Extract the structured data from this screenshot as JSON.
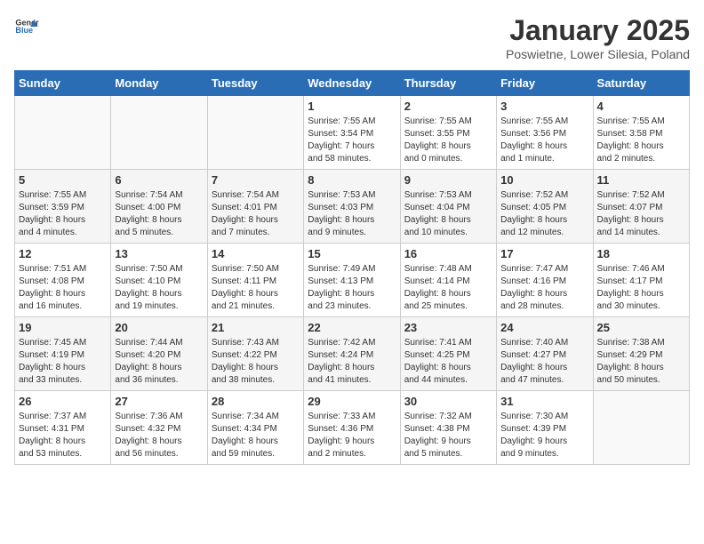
{
  "logo": {
    "general": "General",
    "blue": "Blue"
  },
  "title": "January 2025",
  "subtitle": "Poswietne, Lower Silesia, Poland",
  "days_header": [
    "Sunday",
    "Monday",
    "Tuesday",
    "Wednesday",
    "Thursday",
    "Friday",
    "Saturday"
  ],
  "weeks": [
    [
      {
        "day": "",
        "info": ""
      },
      {
        "day": "",
        "info": ""
      },
      {
        "day": "",
        "info": ""
      },
      {
        "day": "1",
        "info": "Sunrise: 7:55 AM\nSunset: 3:54 PM\nDaylight: 7 hours\nand 58 minutes."
      },
      {
        "day": "2",
        "info": "Sunrise: 7:55 AM\nSunset: 3:55 PM\nDaylight: 8 hours\nand 0 minutes."
      },
      {
        "day": "3",
        "info": "Sunrise: 7:55 AM\nSunset: 3:56 PM\nDaylight: 8 hours\nand 1 minute."
      },
      {
        "day": "4",
        "info": "Sunrise: 7:55 AM\nSunset: 3:58 PM\nDaylight: 8 hours\nand 2 minutes."
      }
    ],
    [
      {
        "day": "5",
        "info": "Sunrise: 7:55 AM\nSunset: 3:59 PM\nDaylight: 8 hours\nand 4 minutes."
      },
      {
        "day": "6",
        "info": "Sunrise: 7:54 AM\nSunset: 4:00 PM\nDaylight: 8 hours\nand 5 minutes."
      },
      {
        "day": "7",
        "info": "Sunrise: 7:54 AM\nSunset: 4:01 PM\nDaylight: 8 hours\nand 7 minutes."
      },
      {
        "day": "8",
        "info": "Sunrise: 7:53 AM\nSunset: 4:03 PM\nDaylight: 8 hours\nand 9 minutes."
      },
      {
        "day": "9",
        "info": "Sunrise: 7:53 AM\nSunset: 4:04 PM\nDaylight: 8 hours\nand 10 minutes."
      },
      {
        "day": "10",
        "info": "Sunrise: 7:52 AM\nSunset: 4:05 PM\nDaylight: 8 hours\nand 12 minutes."
      },
      {
        "day": "11",
        "info": "Sunrise: 7:52 AM\nSunset: 4:07 PM\nDaylight: 8 hours\nand 14 minutes."
      }
    ],
    [
      {
        "day": "12",
        "info": "Sunrise: 7:51 AM\nSunset: 4:08 PM\nDaylight: 8 hours\nand 16 minutes."
      },
      {
        "day": "13",
        "info": "Sunrise: 7:50 AM\nSunset: 4:10 PM\nDaylight: 8 hours\nand 19 minutes."
      },
      {
        "day": "14",
        "info": "Sunrise: 7:50 AM\nSunset: 4:11 PM\nDaylight: 8 hours\nand 21 minutes."
      },
      {
        "day": "15",
        "info": "Sunrise: 7:49 AM\nSunset: 4:13 PM\nDaylight: 8 hours\nand 23 minutes."
      },
      {
        "day": "16",
        "info": "Sunrise: 7:48 AM\nSunset: 4:14 PM\nDaylight: 8 hours\nand 25 minutes."
      },
      {
        "day": "17",
        "info": "Sunrise: 7:47 AM\nSunset: 4:16 PM\nDaylight: 8 hours\nand 28 minutes."
      },
      {
        "day": "18",
        "info": "Sunrise: 7:46 AM\nSunset: 4:17 PM\nDaylight: 8 hours\nand 30 minutes."
      }
    ],
    [
      {
        "day": "19",
        "info": "Sunrise: 7:45 AM\nSunset: 4:19 PM\nDaylight: 8 hours\nand 33 minutes."
      },
      {
        "day": "20",
        "info": "Sunrise: 7:44 AM\nSunset: 4:20 PM\nDaylight: 8 hours\nand 36 minutes."
      },
      {
        "day": "21",
        "info": "Sunrise: 7:43 AM\nSunset: 4:22 PM\nDaylight: 8 hours\nand 38 minutes."
      },
      {
        "day": "22",
        "info": "Sunrise: 7:42 AM\nSunset: 4:24 PM\nDaylight: 8 hours\nand 41 minutes."
      },
      {
        "day": "23",
        "info": "Sunrise: 7:41 AM\nSunset: 4:25 PM\nDaylight: 8 hours\nand 44 minutes."
      },
      {
        "day": "24",
        "info": "Sunrise: 7:40 AM\nSunset: 4:27 PM\nDaylight: 8 hours\nand 47 minutes."
      },
      {
        "day": "25",
        "info": "Sunrise: 7:38 AM\nSunset: 4:29 PM\nDaylight: 8 hours\nand 50 minutes."
      }
    ],
    [
      {
        "day": "26",
        "info": "Sunrise: 7:37 AM\nSunset: 4:31 PM\nDaylight: 8 hours\nand 53 minutes."
      },
      {
        "day": "27",
        "info": "Sunrise: 7:36 AM\nSunset: 4:32 PM\nDaylight: 8 hours\nand 56 minutes."
      },
      {
        "day": "28",
        "info": "Sunrise: 7:34 AM\nSunset: 4:34 PM\nDaylight: 8 hours\nand 59 minutes."
      },
      {
        "day": "29",
        "info": "Sunrise: 7:33 AM\nSunset: 4:36 PM\nDaylight: 9 hours\nand 2 minutes."
      },
      {
        "day": "30",
        "info": "Sunrise: 7:32 AM\nSunset: 4:38 PM\nDaylight: 9 hours\nand 5 minutes."
      },
      {
        "day": "31",
        "info": "Sunrise: 7:30 AM\nSunset: 4:39 PM\nDaylight: 9 hours\nand 9 minutes."
      },
      {
        "day": "",
        "info": ""
      }
    ]
  ]
}
